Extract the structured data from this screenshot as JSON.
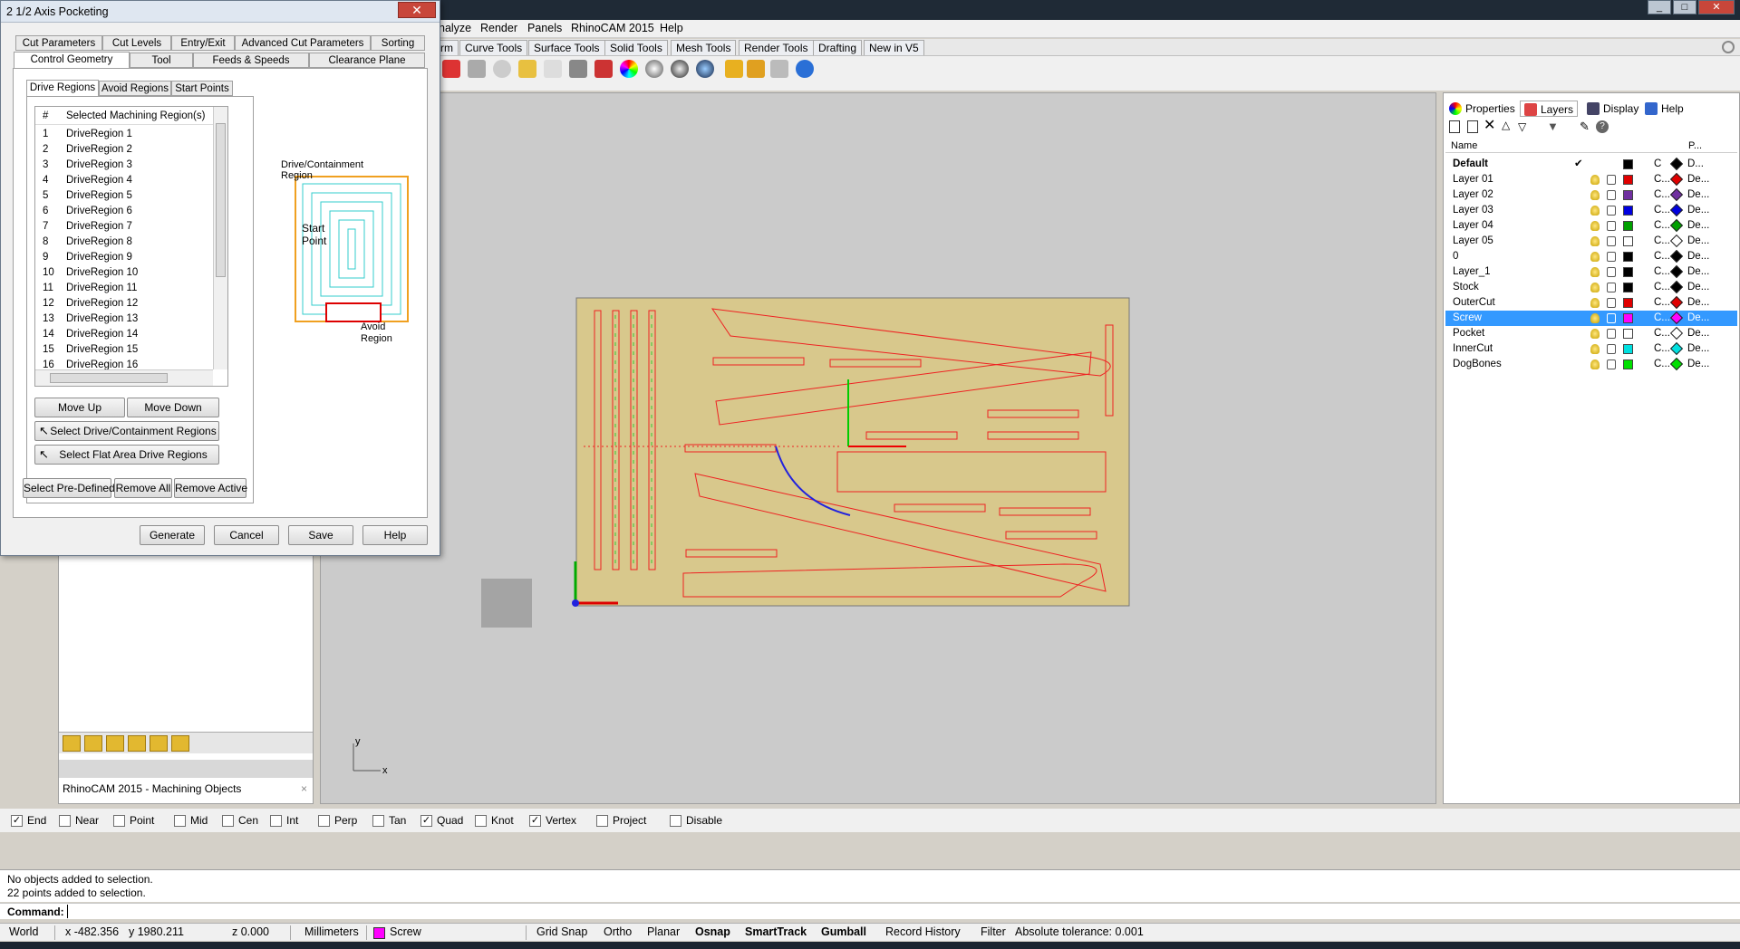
{
  "window": {
    "min": "_",
    "max": "□",
    "close": "✕"
  },
  "menu": {
    "items": [
      "nalyze",
      "Render",
      "Panels",
      "RhinoCAM 2015",
      "Help"
    ]
  },
  "toolbar_tabs": [
    "rm",
    "Curve Tools",
    "Surface Tools",
    "Solid Tools",
    "Mesh Tools",
    "Render Tools",
    "Drafting",
    "New in V5"
  ],
  "left_panel": {
    "title": "RhinoCAM 2015 - Machining Objects",
    "close": "×"
  },
  "right_panel": {
    "tabs": [
      "Properties",
      "Layers",
      "Display",
      "Help"
    ],
    "columns": {
      "name": "Name",
      "p": "P..."
    },
    "layers": [
      {
        "name": "Default",
        "check": "✔",
        "color": "#000000",
        "c": "C",
        "de": "D...",
        "bold": true
      },
      {
        "name": "Layer 01",
        "color": "#e00000",
        "c": "C...",
        "de": "De..."
      },
      {
        "name": "Layer 02",
        "color": "#7030a0",
        "c": "C...",
        "de": "De..."
      },
      {
        "name": "Layer 03",
        "color": "#0000e0",
        "c": "C...",
        "de": "De..."
      },
      {
        "name": "Layer 04",
        "color": "#00a000",
        "c": "C...",
        "de": "De..."
      },
      {
        "name": "Layer 05",
        "color": "#ffffff",
        "c": "C...",
        "de": "De..."
      },
      {
        "name": "0",
        "color": "#000000",
        "c": "C...",
        "de": "De..."
      },
      {
        "name": "Layer_1",
        "color": "#000000",
        "c": "C...",
        "de": "De..."
      },
      {
        "name": "Stock",
        "color": "#000000",
        "c": "C...",
        "de": "De..."
      },
      {
        "name": "OuterCut",
        "color": "#e00000",
        "c": "C...",
        "de": "De..."
      },
      {
        "name": "Screw",
        "color": "#ff00ff",
        "c": "C...",
        "de": "De...",
        "selected": true
      },
      {
        "name": "Pocket",
        "color": "#ffffff",
        "c": "C...",
        "de": "De..."
      },
      {
        "name": "InnerCut",
        "color": "#00e0e0",
        "c": "C...",
        "de": "De..."
      },
      {
        "name": "DogBones",
        "color": "#00e000",
        "c": "C...",
        "de": "De..."
      }
    ]
  },
  "viewport_axis": {
    "y": "y",
    "x": "x"
  },
  "osnap": [
    {
      "label": "End",
      "checked": true
    },
    {
      "label": "Near",
      "checked": false
    },
    {
      "label": "Point",
      "checked": false
    },
    {
      "label": "Mid",
      "checked": false
    },
    {
      "label": "Cen",
      "checked": false
    },
    {
      "label": "Int",
      "checked": false
    },
    {
      "label": "Perp",
      "checked": false
    },
    {
      "label": "Tan",
      "checked": false
    },
    {
      "label": "Quad",
      "checked": true
    },
    {
      "label": "Knot",
      "checked": false
    },
    {
      "label": "Vertex",
      "checked": true
    },
    {
      "label": "Project",
      "checked": false
    },
    {
      "label": "Disable",
      "checked": false
    }
  ],
  "command_history": [
    "No objects added to selection.",
    "22 points added to selection."
  ],
  "command": {
    "label": "Command:",
    "value": ""
  },
  "status": {
    "cplane": "World",
    "x": "x -482.356",
    "y": "y 1980.211",
    "z": "z 0.000",
    "units": "Millimeters",
    "layer": "Screw",
    "layer_color": "#ff00ff",
    "toggles": [
      "Grid Snap",
      "Ortho",
      "Planar",
      "Osnap",
      "SmartTrack",
      "Gumball",
      "Record History",
      "Filter"
    ],
    "tolerance": "Absolute tolerance: 0.001"
  },
  "dialog": {
    "title": "2 1/2 Axis Pocketing",
    "close": "✕",
    "tabs_row1": [
      "Cut Parameters",
      "Cut Levels",
      "Entry/Exit",
      "Advanced Cut Parameters",
      "Sorting"
    ],
    "tabs_row2": [
      "Control Geometry",
      "Tool",
      "Feeds & Speeds",
      "Clearance Plane"
    ],
    "subtabs": [
      "Drive Regions",
      "Avoid Regions",
      "Start Points"
    ],
    "list_header": {
      "num": "#",
      "label": "Selected Machining Region(s)"
    },
    "regions": [
      {
        "n": "1",
        "label": "DriveRegion 1"
      },
      {
        "n": "2",
        "label": "DriveRegion 2"
      },
      {
        "n": "3",
        "label": "DriveRegion 3"
      },
      {
        "n": "4",
        "label": "DriveRegion 4"
      },
      {
        "n": "5",
        "label": "DriveRegion 5"
      },
      {
        "n": "6",
        "label": "DriveRegion 6"
      },
      {
        "n": "7",
        "label": "DriveRegion 7"
      },
      {
        "n": "8",
        "label": "DriveRegion 8"
      },
      {
        "n": "9",
        "label": "DriveRegion 9"
      },
      {
        "n": "10",
        "label": "DriveRegion 10"
      },
      {
        "n": "11",
        "label": "DriveRegion 11"
      },
      {
        "n": "12",
        "label": "DriveRegion 12"
      },
      {
        "n": "13",
        "label": "DriveRegion 13"
      },
      {
        "n": "14",
        "label": "DriveRegion 14"
      },
      {
        "n": "15",
        "label": "DriveRegion 15"
      },
      {
        "n": "16",
        "label": "DriveRegion 16"
      }
    ],
    "illustration": {
      "drive": "Drive/Containment Region",
      "start1": "Start",
      "start2": "Point",
      "avoid1": "Avoid",
      "avoid2": "Region"
    },
    "buttons": {
      "move_up": "Move Up",
      "move_down": "Move Down",
      "select_drive": "Select Drive/Containment Regions",
      "select_flat": "Select Flat Area Drive Regions",
      "select_predefined": "Select Pre-Defined",
      "remove_all": "Remove All",
      "remove_active": "Remove Active",
      "generate": "Generate",
      "cancel": "Cancel",
      "save": "Save",
      "help": "Help"
    }
  }
}
